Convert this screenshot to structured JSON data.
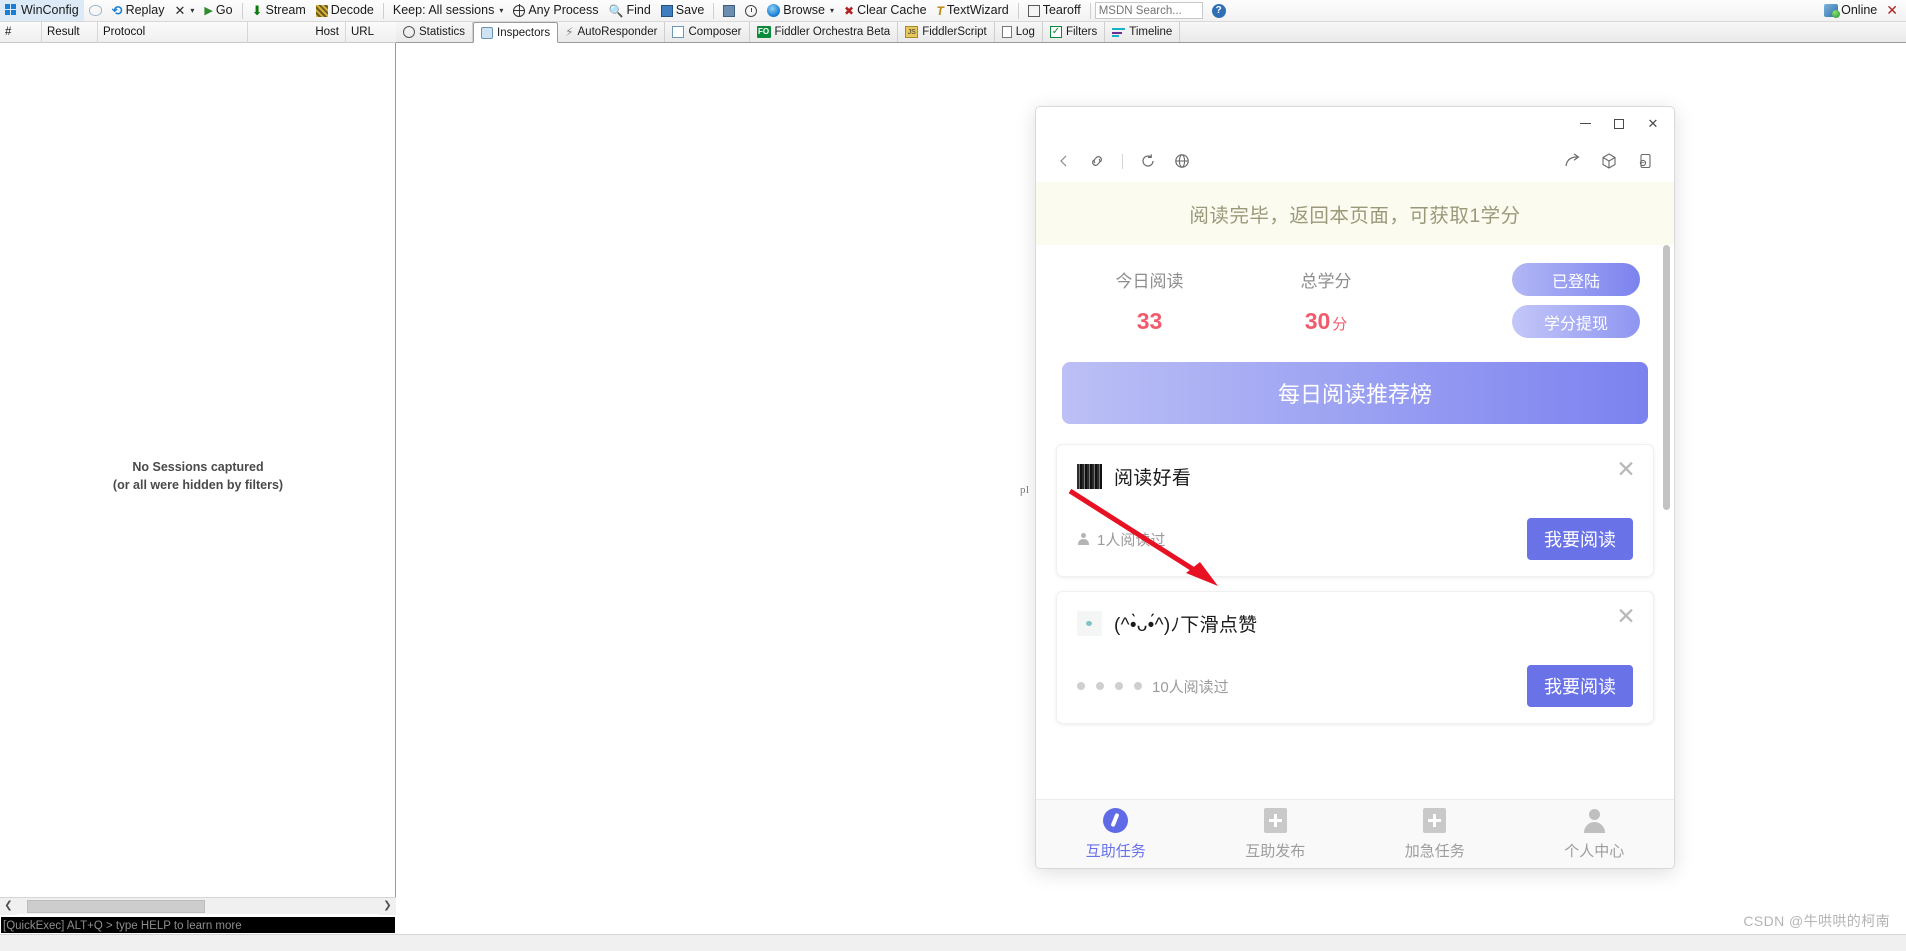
{
  "toolbar": {
    "items": [
      {
        "icon": "windows-icon",
        "label": "WinConfig"
      },
      {
        "icon": "speech-bubble-icon",
        "label": ""
      },
      {
        "icon": "replay-icon",
        "label": "Replay"
      },
      {
        "icon": "x-icon",
        "label": "",
        "caret": "▾"
      },
      {
        "icon": "play-icon",
        "label": "Go"
      },
      {
        "icon": "stream-icon",
        "label": "Stream"
      },
      {
        "icon": "decode-icon",
        "label": "Decode"
      },
      {
        "icon": "keep-sessions-icon",
        "label": "Keep: All sessions",
        "caret": "▾"
      },
      {
        "icon": "any-process-icon",
        "label": "Any Process"
      },
      {
        "icon": "find-icon",
        "label": "Find"
      },
      {
        "icon": "save-icon",
        "label": "Save"
      },
      {
        "icon": "camera-icon",
        "label": ""
      },
      {
        "icon": "clock-icon",
        "label": ""
      },
      {
        "icon": "browse-icon",
        "label": "Browse",
        "caret": "▾"
      },
      {
        "icon": "clear-cache-icon",
        "label": "Clear Cache"
      },
      {
        "icon": "textwizard-icon",
        "label": "TextWizard"
      },
      {
        "icon": "tearoff-icon",
        "label": "Tearoff"
      }
    ],
    "msdn_placeholder": "MSDN Search...",
    "help_icon": "question-mark-icon",
    "online_label": "Online",
    "close_label": "✕"
  },
  "session_columns": [
    "#",
    "Result",
    "Protocol",
    "",
    "Host",
    "URL"
  ],
  "sessions": {
    "empty_line1": "No Sessions captured",
    "empty_line2": "(or all were hidden by filters)"
  },
  "tabs": [
    {
      "label": "Statistics",
      "icon": "statistics-icon",
      "active": false
    },
    {
      "label": "Inspectors",
      "icon": "inspectors-icon",
      "active": true
    },
    {
      "label": "AutoResponder",
      "icon": "autoresponder-icon",
      "active": false
    },
    {
      "label": "Composer",
      "icon": "composer-icon",
      "active": false
    },
    {
      "label": "Fiddler Orchestra Beta",
      "icon": "fiddler-orchestra-icon",
      "active": false
    },
    {
      "label": "FiddlerScript",
      "icon": "fiddlerscript-icon",
      "active": false
    },
    {
      "label": "Log",
      "icon": "log-icon",
      "active": false
    },
    {
      "label": "Filters",
      "icon": "filters-icon",
      "active": false
    },
    {
      "label": "Timeline",
      "icon": "timeline-icon",
      "active": false
    }
  ],
  "quickexec": "[QuickExec] ALT+Q > type HELP to learn more",
  "page_fragment": "pl",
  "popup": {
    "window_buttons": {
      "minimize": "minimize-icon",
      "maximize": "maximize-icon",
      "close": "close-icon"
    },
    "nav_left": [
      "back-icon",
      "link-icon",
      "divider",
      "refresh-icon",
      "globe-icon"
    ],
    "nav_right": [
      "share-icon",
      "package-icon",
      "more-icon"
    ],
    "banner": "阅读完毕，返回本页面，可获取1学分",
    "stats": [
      {
        "label": "今日阅读",
        "value": "33",
        "unit": ""
      },
      {
        "label": "总学分",
        "value": "30",
        "unit": "分"
      }
    ],
    "pills": [
      {
        "label": "已登陆"
      },
      {
        "label": "学分提现"
      }
    ],
    "primary_button": "每日阅读推荐榜",
    "cards": [
      {
        "thumb": "article-thumbnail-dark",
        "title": "阅读好看",
        "readers": "1人阅读过",
        "reader_icon": "person-icon",
        "action": "我要阅读",
        "close": "✕",
        "dots": 0
      },
      {
        "thumb": "article-thumbnail-light",
        "title": "(^•̀ᴗ•́^)ﾉ下滑点赞",
        "readers": "10人阅读过",
        "reader_icon": "person-icon",
        "action": "我要阅读",
        "close": "✕",
        "dots": 4
      }
    ],
    "tabbar": [
      {
        "label": "互助任务",
        "icon": "compass-icon",
        "active": true
      },
      {
        "label": "互助发布",
        "icon": "plus-square-icon",
        "active": false
      },
      {
        "label": "加急任务",
        "icon": "plus-square-icon",
        "active": false
      },
      {
        "label": "个人中心",
        "icon": "person-icon",
        "active": false
      }
    ]
  },
  "annotation": {
    "type": "red-arrow",
    "color": "#e81123"
  },
  "watermark": "CSDN @牛哄哄的柯南",
  "colors": {
    "accent": "#6a72e8",
    "stat_value": "#f25b6b",
    "banner_bg": "#fbfbf0",
    "banner_text": "#9a9a7a"
  }
}
